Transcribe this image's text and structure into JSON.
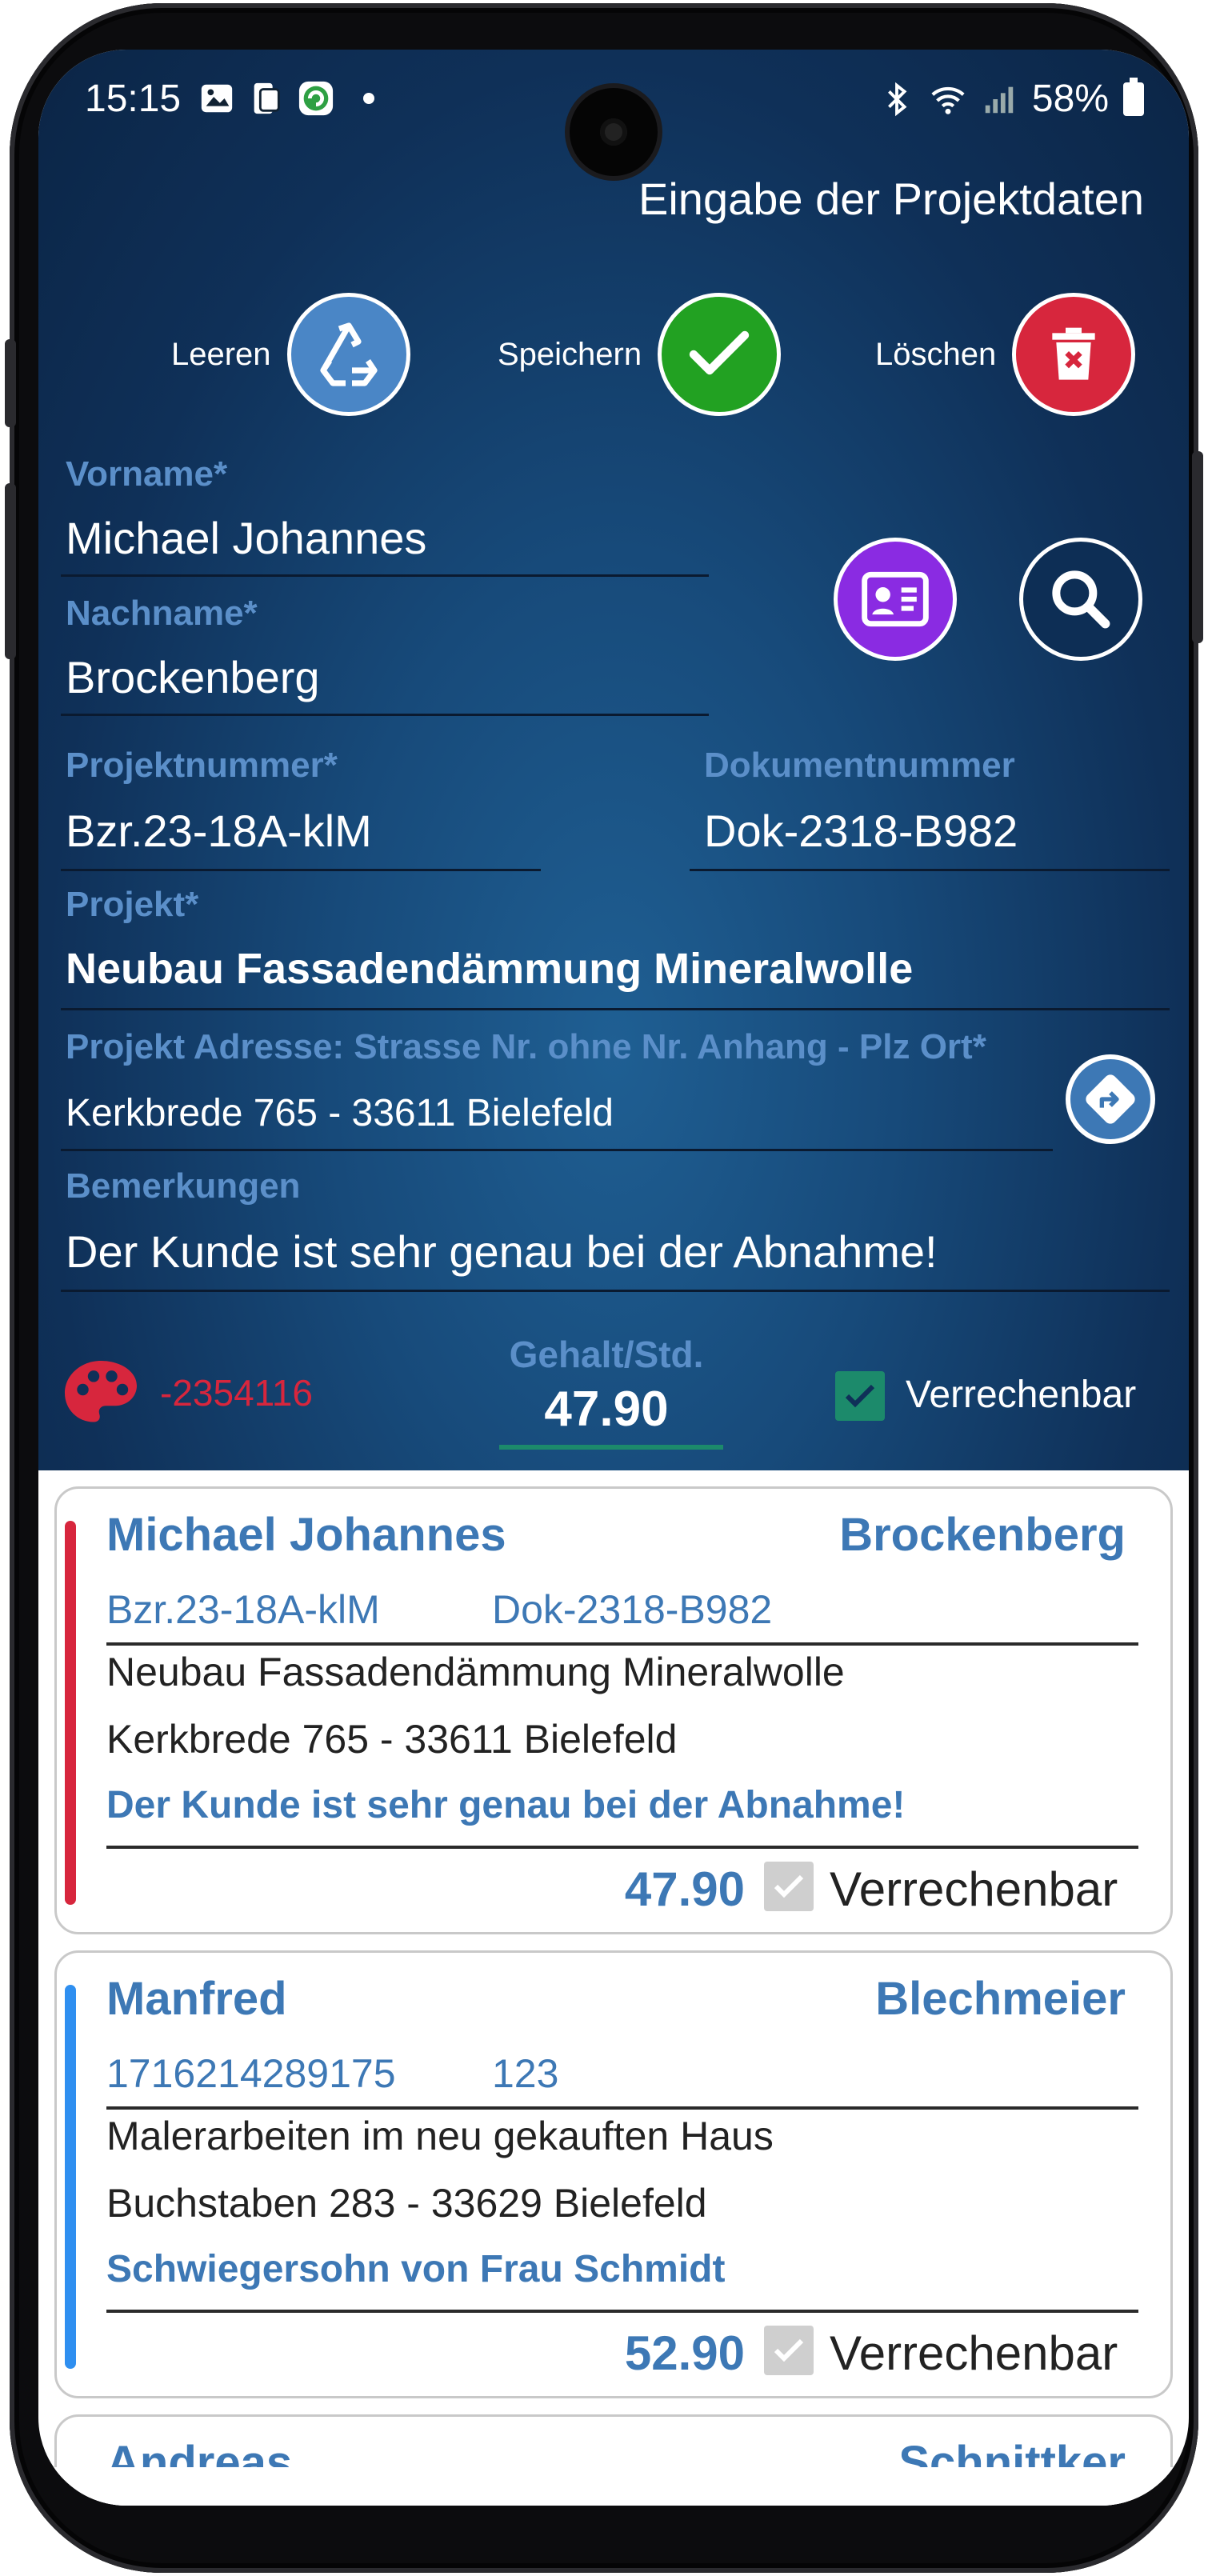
{
  "statusbar": {
    "time": "15:15",
    "battery": "58%"
  },
  "header": {
    "title": "Eingabe der Projektdaten"
  },
  "actions": {
    "clear_label": "Leeren",
    "save_label": "Speichern",
    "delete_label": "Löschen"
  },
  "form": {
    "vorname_label": "Vorname*",
    "vorname_value": "Michael Johannes",
    "nachname_label": "Nachname*",
    "nachname_value": "Brockenberg",
    "projektnummer_label": "Projektnummer*",
    "projektnummer_value": "Bzr.23-18A-klM",
    "dokumentnummer_label": "Dokumentnummer",
    "dokumentnummer_value": "Dok-2318-B982",
    "projekt_label": "Projekt*",
    "projekt_value": "Neubau Fassadendämmung Mineralwolle",
    "adresse_label": "Projekt Adresse: Strasse Nr. ohne Nr. Anhang - Plz Ort*",
    "adresse_value": "Kerkbrede 765 - 33611 Bielefeld",
    "bemerkungen_label": "Bemerkungen",
    "bemerkungen_value": "Der Kunde ist sehr genau bei der Abnahme!",
    "color_code": "-2354116",
    "gehalt_label": "Gehalt/Std.",
    "gehalt_value": "47.90",
    "verrechenbar_label": "Verrechenbar",
    "verrechenbar_checked": true
  },
  "colors": {
    "header_bg": "#0f3058",
    "label_blue": "#5b8fc9",
    "card_blue": "#3d78b5",
    "save_green": "#22a122",
    "delete_red": "#d7263d",
    "contact_purple": "#8a2be2",
    "clear_blue": "#4a86c6"
  },
  "records": [
    {
      "first": "Michael Johannes",
      "last": "Brockenberg",
      "projnr": "Bzr.23-18A-klM",
      "doknr": "Dok-2318-B982",
      "projekt": "Neubau Fassadendämmung Mineralwolle",
      "adresse": "Kerkbrede 765 - 33611 Bielefeld",
      "bemerkung": "Der Kunde ist sehr genau bei der Abnahme!",
      "rate": "47.90",
      "verrechenbar": "Verrechenbar",
      "accent": "#d7263d"
    },
    {
      "first": "Manfred",
      "last": "Blechmeier",
      "projnr": "1716214289175",
      "doknr": "123",
      "projekt": "Malerarbeiten im neu gekauften Haus",
      "adresse": "Buchstaben 283 - 33629 Bielefeld",
      "bemerkung": "Schwiegersohn von Frau Schmidt",
      "rate": "52.90",
      "verrechenbar": "Verrechenbar",
      "accent": "#2f8ff0"
    },
    {
      "first": "Andreas",
      "last": "Schnittker"
    }
  ]
}
